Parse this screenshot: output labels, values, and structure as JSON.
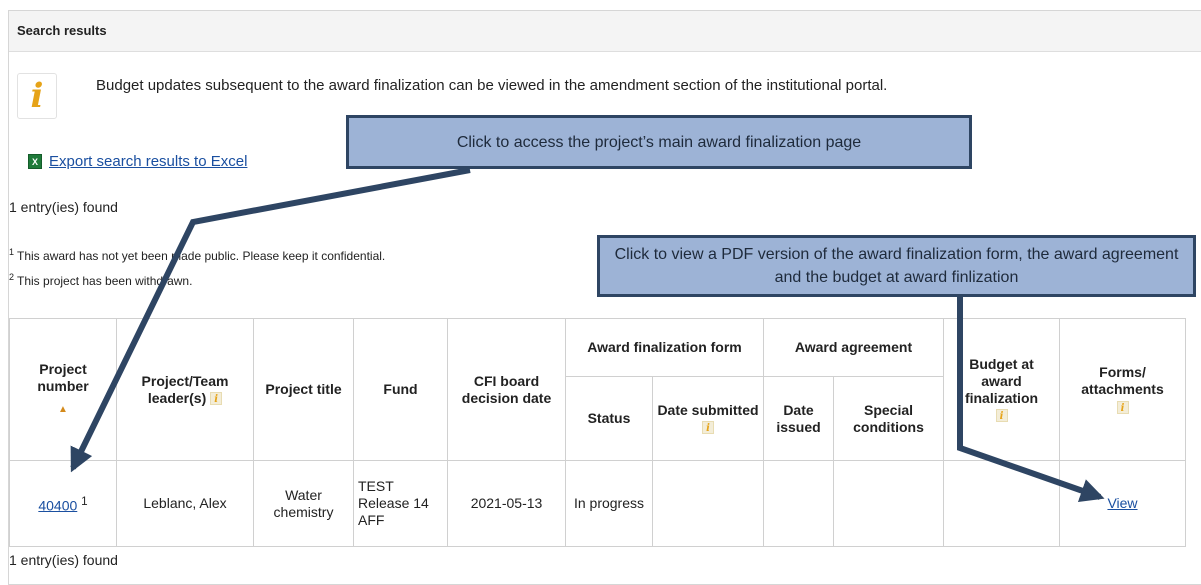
{
  "header": {
    "title": "Search results"
  },
  "info": {
    "icon": "info-icon",
    "message": "Budget updates subsequent to the award finalization can be viewed in the amendment section of the institutional portal."
  },
  "export": {
    "icon": "excel-icon",
    "label": "Export search results to Excel"
  },
  "results_count_top": "1 entry(ies) found",
  "footnotes": [
    {
      "num": "1",
      "text": "This award has not yet been made public. Please keep it confidential."
    },
    {
      "num": "2",
      "text": "This project has been withdrawn."
    }
  ],
  "table": {
    "headers": {
      "project_number": "Project number",
      "leaders": "Project/Team leader(s)",
      "title": "Project title",
      "fund": "Fund",
      "decision_date": "CFI board decision date",
      "form_group": "Award finalization form",
      "status": "Status",
      "date_submitted": "Date submitted",
      "agreement_group": "Award agreement",
      "date_issued": "Date issued",
      "special_conditions": "Special conditions",
      "budget": "Budget at award finalization",
      "forms": "Forms/ attachments"
    },
    "rows": [
      {
        "project_number": "40400",
        "footnote_ref": "1",
        "leader": "Leblanc, Alex",
        "title": "Water chemistry",
        "fund": "TEST Release 14 AFF",
        "decision_date": "2021-05-13",
        "status": "In progress",
        "date_submitted": "",
        "date_issued": "",
        "special_conditions": "",
        "budget": "",
        "forms_link": "View"
      }
    ]
  },
  "results_count_bottom": "1 entry(ies) found",
  "callouts": {
    "project_link": "Click to access the project’s main award finalization page",
    "view_pdf": "Click to view a PDF version of the award finalization form, the award agreement and the budget at award finlization"
  },
  "colors": {
    "callout_fill": "#9db3d6",
    "callout_border": "#2e4563",
    "link": "#1a4fa0",
    "info_accent": "#e6a318"
  }
}
